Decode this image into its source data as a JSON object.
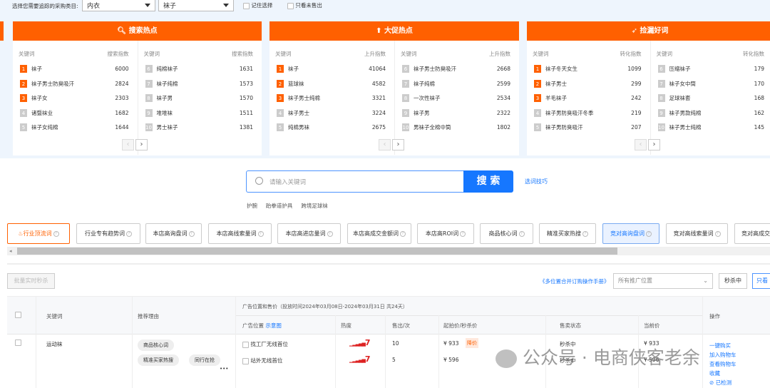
{
  "filter": {
    "label": "选择您需要追踪的采购类目:",
    "category1": "内衣",
    "category2": "袜子",
    "remember": "记住选择",
    "unsold_only": "只看未售出"
  },
  "panels": [
    {
      "title": "搜索热点",
      "icon": "search-icon",
      "col_keyword": "关键词",
      "col_index": "搜索指数",
      "items": [
        [
          "1",
          "袜子",
          "6000"
        ],
        [
          "2",
          "袜子男士防臭吸汗",
          "2824"
        ],
        [
          "3",
          "袜子女",
          "2303"
        ],
        [
          "4",
          "诸暨袜业",
          "1682"
        ],
        [
          "5",
          "袜子女纯棉",
          "1644"
        ],
        [
          "6",
          "纯棉袜子",
          "1631"
        ],
        [
          "7",
          "袜子纯棉",
          "1573"
        ],
        [
          "8",
          "袜子男",
          "1570"
        ],
        [
          "9",
          "堆堆袜",
          "1511"
        ],
        [
          "10",
          "男士袜子",
          "1381"
        ]
      ]
    },
    {
      "title": "大促热点",
      "icon": "arrow-up-icon",
      "col_keyword": "关键词",
      "col_index": "上升指数",
      "items": [
        [
          "1",
          "袜子",
          "41064"
        ],
        [
          "2",
          "篮球袜",
          "4582"
        ],
        [
          "3",
          "袜子男士纯棉",
          "3321"
        ],
        [
          "4",
          "袜子男士",
          "3224"
        ],
        [
          "5",
          "纯棉男袜",
          "2675"
        ],
        [
          "6",
          "袜子男士防臭吸汗",
          "2668"
        ],
        [
          "7",
          "袜子纯棉",
          "2599"
        ],
        [
          "8",
          "一次性袜子",
          "2534"
        ],
        [
          "9",
          "袜子男",
          "2322"
        ],
        [
          "10",
          "男袜子全棉中筒",
          "1802"
        ]
      ]
    },
    {
      "title": "捡漏好词",
      "icon": "cursor-icon",
      "col_keyword": "关键词",
      "col_index": "转化指数",
      "items": [
        [
          "1",
          "袜子冬天女生",
          "1099"
        ],
        [
          "2",
          "袜子男士",
          "299"
        ],
        [
          "3",
          "羊毛袜子",
          "242"
        ],
        [
          "4",
          "袜子男防臭吸汗冬季",
          "219"
        ],
        [
          "5",
          "袜子男防臭吸汗",
          "207"
        ],
        [
          "6",
          "压缩袜子",
          "179"
        ],
        [
          "7",
          "袜子女中筒",
          "170"
        ],
        [
          "8",
          "足球袜套",
          "168"
        ],
        [
          "9",
          "袜子男款纯棉",
          "162"
        ],
        [
          "10",
          "袜子男士纯棉",
          "145"
        ]
      ]
    }
  ],
  "search": {
    "placeholder": "请输入关键词",
    "button": "搜 索",
    "tips": "选词技巧",
    "suggestions": [
      "护腕",
      "跆拳道护具",
      "跨境足球袜"
    ]
  },
  "tabs": [
    "行业顶流词",
    "行业专有趋势词",
    "本店高询盘词",
    "本店高线索量词",
    "本店高进店量词",
    "本店高成交金额词",
    "本店高ROI词",
    "商品核心词",
    "精准买家热搜",
    "竞对高询盘词",
    "竞对高线索量词",
    "竞对高成交"
  ],
  "toolbar": {
    "batch": "批量实时秒杀",
    "manual": "《多位置合并订购操作手册》",
    "position_select": "所有推广位置",
    "seckill": "秒杀中",
    "only_view": "只看"
  },
  "table": {
    "headers": {
      "keyword": "关键词",
      "reason": "推荐理由",
      "group": "广告位置和售价（投放时间2024年03月08日-2024年03月31日 共24天）",
      "position": "广告位置",
      "diagram": "示意图",
      "heat": "热度",
      "sold": "售出/次",
      "price": "起拍价/秒杀价",
      "status": "售卖状态",
      "current": "当前价",
      "action": "操作"
    },
    "rows": [
      {
        "keyword": "运动袜",
        "reasons": [
          "商品核心词",
          "精准买家热搜",
          "同行在抢"
        ],
        "more": "•••",
        "slots": [
          {
            "name": "找工厂无线首位",
            "heat": "7",
            "sold": "10",
            "price": "¥ 933",
            "badge": "降价",
            "status": "秒杀中",
            "current": "¥ 933"
          },
          {
            "name": "站外无线首位",
            "heat": "7",
            "sold": "5",
            "price": "¥ 596",
            "status": "秒杀中",
            "current": "¥ 596"
          }
        ],
        "actions": [
          "一键购买",
          "加入购物车",
          "查看购物车",
          "收藏",
          "已检测"
        ]
      }
    ]
  },
  "watermark": "公众号 · 电商侠客老余",
  "colors": {
    "orange": "#ff6000",
    "blue": "#1677ff"
  }
}
